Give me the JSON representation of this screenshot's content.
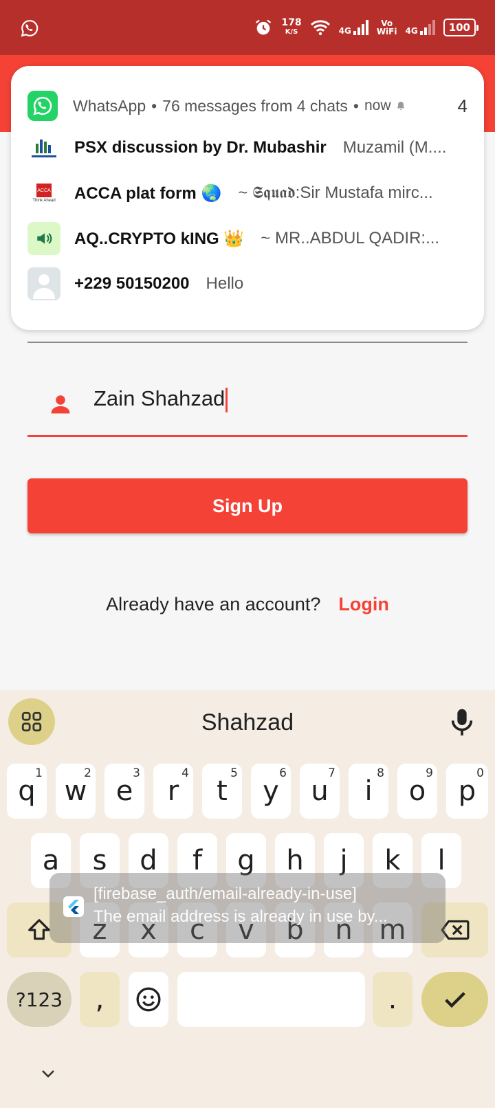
{
  "status_bar": {
    "net_speed_value": "178",
    "net_speed_unit": "K/S",
    "sim1_label": "4G",
    "volte_top": "Vo",
    "volte_bottom": "WiFi",
    "sim2_label": "4G",
    "battery": "100",
    "icons": [
      "whatsapp-icon",
      "alarm-icon",
      "wifi-icon",
      "signal-icon",
      "battery-icon"
    ]
  },
  "notification": {
    "app": "WhatsApp",
    "summary": "76 messages from 4 chats",
    "time": "now",
    "count": "4",
    "sep": "•",
    "rows": [
      {
        "title": "PSX discussion by Dr. Mubashir",
        "message": "Muzamil (M...."
      },
      {
        "title": "ACCA plat form 🌏",
        "message": "~ 𝕾𝖖𝖚𝖆𝖉:Sir Mustafa mirc..."
      },
      {
        "title": "AQ..CRYPTO kING 👑",
        "message": "~ MR..ABDUL QADIR:..."
      },
      {
        "title": "+229 50150200",
        "message": "Hello"
      }
    ],
    "avatar_labels": {
      "acca": "ACCA",
      "acca_sub": "Think Ahead"
    }
  },
  "form": {
    "name_value": "Zain Shahzad",
    "signup_label": "Sign Up",
    "already_text": "Already have an account?",
    "login_label": "Login"
  },
  "keyboard": {
    "suggestion": "Shahzad",
    "row1": [
      {
        "k": "q",
        "n": "1"
      },
      {
        "k": "w",
        "n": "2"
      },
      {
        "k": "e",
        "n": "3"
      },
      {
        "k": "r",
        "n": "4"
      },
      {
        "k": "t",
        "n": "5"
      },
      {
        "k": "y",
        "n": "6"
      },
      {
        "k": "u",
        "n": "7"
      },
      {
        "k": "i",
        "n": "8"
      },
      {
        "k": "o",
        "n": "9"
      },
      {
        "k": "p",
        "n": "0"
      }
    ],
    "row2": [
      "a",
      "s",
      "d",
      "f",
      "g",
      "h",
      "j",
      "k",
      "l"
    ],
    "row3": [
      "z",
      "x",
      "c",
      "v",
      "b",
      "n",
      "m"
    ],
    "symbols_label": "?123",
    "comma_label": ",",
    "period_label": "."
  },
  "toast": {
    "line1": "[firebase_auth/email-already-in-use]",
    "line2": "The email address is already in use by..."
  },
  "colors": {
    "status_bar": "#b72f2a",
    "accent": "#f44236",
    "keyboard_bg": "#f5ede3",
    "keyboard_accent": "#ddd18a",
    "whatsapp": "#24d366"
  }
}
